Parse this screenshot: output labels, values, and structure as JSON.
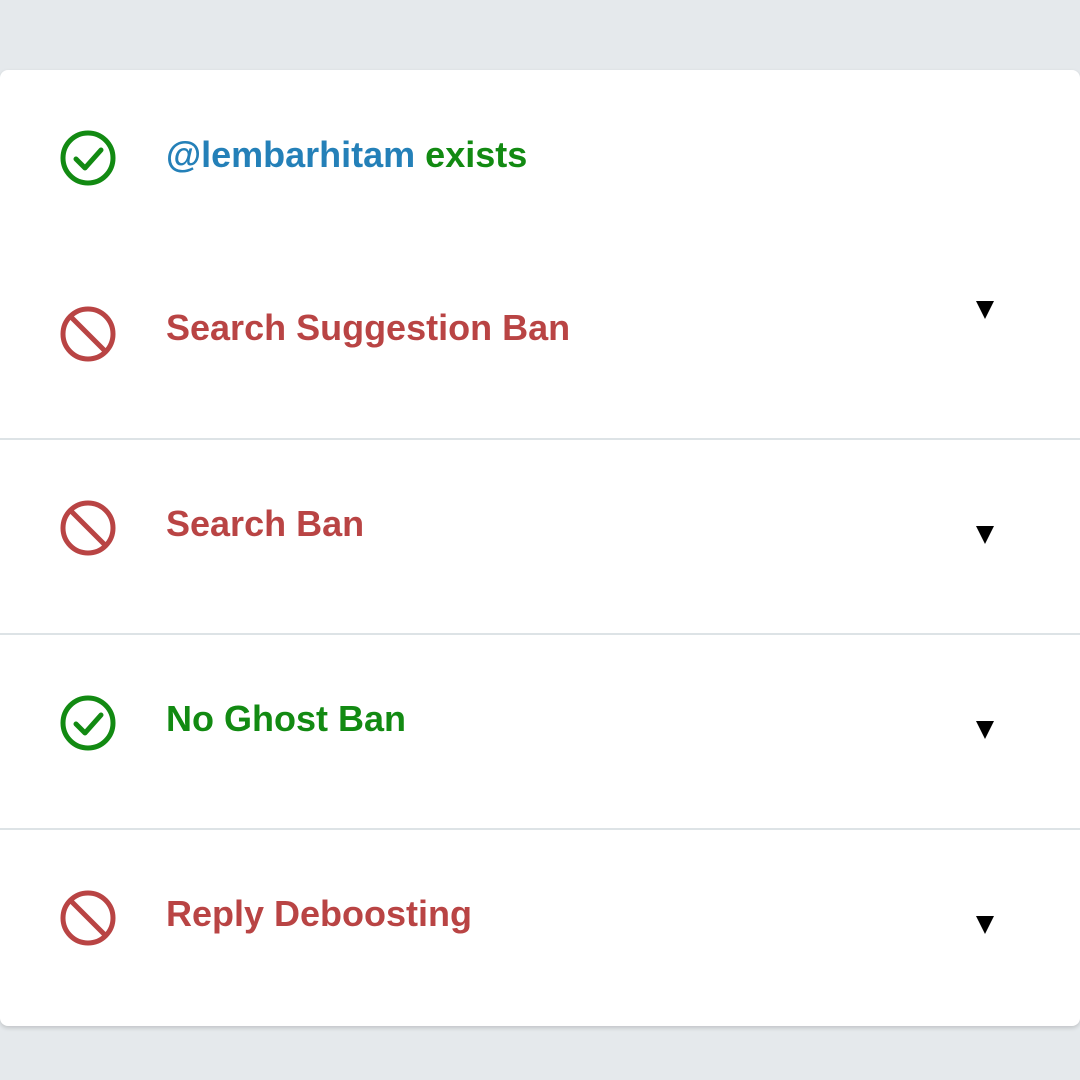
{
  "colors": {
    "page_bg": "#e5e9ec",
    "card_bg": "#ffffff",
    "pass_green": "#128a12",
    "fail_red": "#b94444",
    "handle_blue": "#2480b8",
    "divider": "#dde3e6"
  },
  "account": {
    "handle": "@lembarhitam",
    "status_text": " exists",
    "icon": "check-circle-icon"
  },
  "checks": [
    {
      "label": "Search Suggestion Ban",
      "status": "fail",
      "icon": "ban-icon",
      "toggle_icon": "caret-down-icon"
    },
    {
      "label": "Search Ban",
      "status": "fail",
      "icon": "ban-icon",
      "toggle_icon": "caret-down-icon"
    },
    {
      "label": "No Ghost Ban",
      "status": "pass",
      "icon": "check-circle-icon",
      "toggle_icon": "caret-down-icon"
    },
    {
      "label": "Reply Deboosting",
      "status": "fail",
      "icon": "ban-icon",
      "toggle_icon": "caret-down-icon"
    }
  ]
}
